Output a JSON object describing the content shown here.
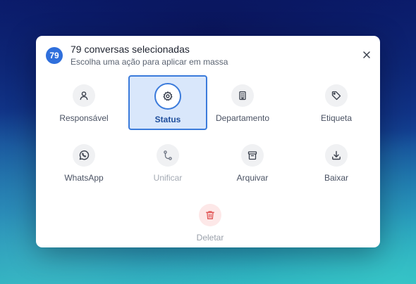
{
  "modal": {
    "count": "79",
    "title": "79 conversas selecionadas",
    "subtitle": "Escolha uma ação para aplicar em massa"
  },
  "actions": [
    {
      "label": "Responsável",
      "icon": "user-icon",
      "state": "normal"
    },
    {
      "label": "Status",
      "icon": "gear-icon",
      "state": "active"
    },
    {
      "label": "Departamento",
      "icon": "building-icon",
      "state": "normal"
    },
    {
      "label": "Etiqueta",
      "icon": "tag-icon",
      "state": "normal"
    },
    {
      "label": "WhatsApp",
      "icon": "whatsapp-icon",
      "state": "normal"
    },
    {
      "label": "Unificar",
      "icon": "merge-icon",
      "state": "disabled"
    },
    {
      "label": "Arquivar",
      "icon": "archive-icon",
      "state": "normal"
    },
    {
      "label": "Baixar",
      "icon": "download-icon",
      "state": "normal"
    },
    {
      "label": "Deletar",
      "icon": "trash-icon",
      "state": "danger"
    }
  ],
  "colors": {
    "accent": "#2f6fdc",
    "active_bg": "#d9e7fb",
    "danger": "#e05252"
  }
}
